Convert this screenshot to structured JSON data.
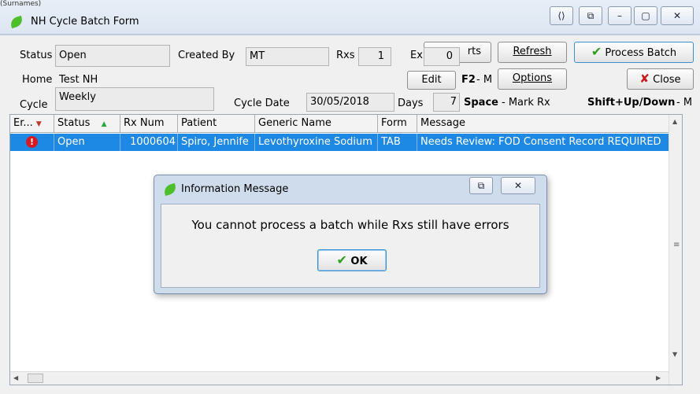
{
  "window": {
    "title": "NH Cycle Batch Form",
    "top_cut_text": "(Surnames)"
  },
  "form": {
    "status_label": "Status",
    "status_value": "Open",
    "created_by_label": "Created By",
    "created_by_value": "MT",
    "rxs_label": "Rxs",
    "rxs_value": "1",
    "ex_label": "Ex",
    "ex_value": "0",
    "home_label": "Home",
    "home_value": "Test NH",
    "cycle_label": "Cycle",
    "cycle_value": "Weekly",
    "cycle_date_label": "Cycle Date",
    "cycle_date_value": "30/05/2018",
    "days_label": "Days",
    "days_value": "7"
  },
  "buttons": {
    "reports": "rts",
    "refresh": "Refresh",
    "process_batch": "Process Batch",
    "edit": "Edit",
    "options": "Options",
    "close": "Close"
  },
  "hints": {
    "f2_key": "F2",
    "f2_text": " - M",
    "space_key": "Space",
    "space_text": " - Mark Rx",
    "shift_key": "Shift+Up/Down",
    "shift_text": " - M"
  },
  "grid": {
    "columns": [
      "Er...",
      "Status",
      "Rx Num",
      "Patient",
      "Generic Name",
      "Form",
      "Message"
    ],
    "rows": [
      {
        "status": "Open",
        "rx_num": "1000604",
        "patient": "Spiro, Jennife",
        "generic_name": "Levothyroxine Sodium",
        "form": "TAB",
        "message": "Needs Review: FOD Consent Record REQUIRED"
      }
    ]
  },
  "dialog": {
    "title": "Information Message",
    "message": "You cannot process a batch while Rxs still have errors",
    "ok_label": "OK"
  },
  "colors": {
    "selection": "#1e88e5",
    "accent_green": "#2e9e1f",
    "close_red": "#cc1111"
  }
}
